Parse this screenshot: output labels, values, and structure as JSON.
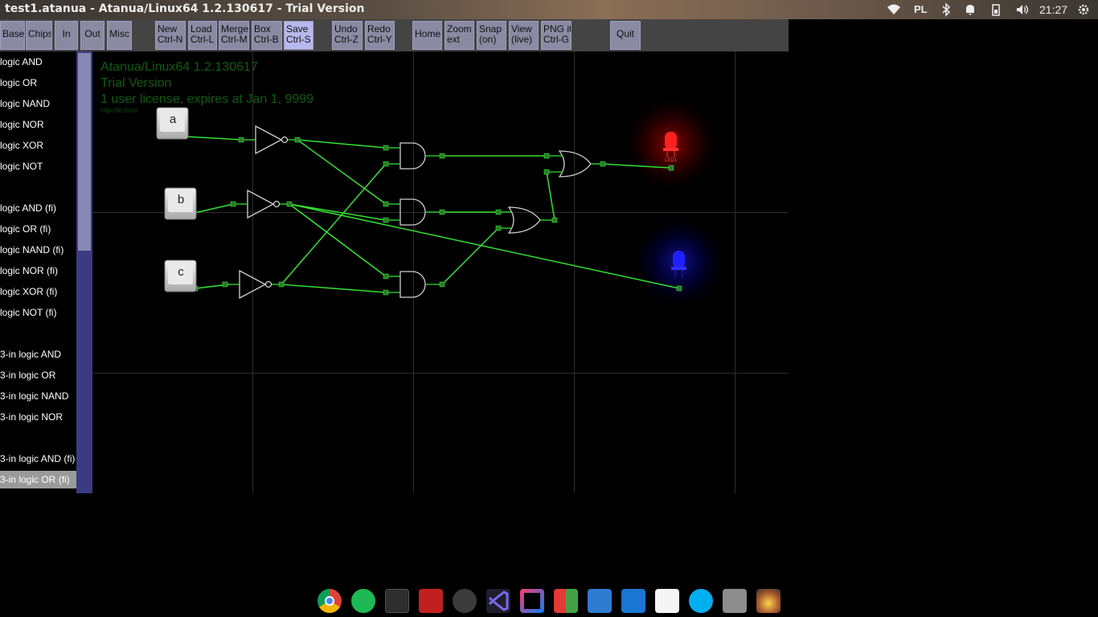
{
  "window": {
    "title": "test1.atanua - Atanua/Linux64 1.2.130617 - Trial Version"
  },
  "tray": {
    "keyboard_layout": "PL",
    "clock": "21:27"
  },
  "toolbar": {
    "base": "Base",
    "chips": "Chips",
    "in": "In",
    "out": "Out",
    "misc": "Misc",
    "new": "New\nCtrl-N",
    "load": "Load\nCtrl-L",
    "merge": "Merge\nCtrl-M",
    "box": "Box\nCtrl-B",
    "save": "Save\nCtrl-S",
    "undo": "Undo\nCtrl-Z",
    "redo": "Redo\nCtrl-Y",
    "home": "Home",
    "zoom": "Zoom\next",
    "snap": "Snap\n(on)",
    "view": "View\n(live)",
    "png": "PNG it\nCtrl-G",
    "quit": "Quit"
  },
  "components": [
    "logic AND",
    "logic OR",
    "logic NAND",
    "logic NOR",
    "logic XOR",
    "logic NOT",
    "",
    "logic AND (fi)",
    "logic OR (fi)",
    "logic NAND (fi)",
    "logic NOR (fi)",
    "logic XOR (fi)",
    "logic NOT (fi)",
    "",
    "3-in logic AND",
    "3-in logic OR",
    "3-in logic NAND",
    "3-in logic NOR",
    "",
    "3-in logic AND (fi)",
    "3-in logic OR (fi)"
  ],
  "selected_component": "3-in logic OR (fi)",
  "watermark": {
    "line1": "Atanua/Linux64 1.2.130617",
    "line2": "Trial Version",
    "line3": "1 user license, expires at Jan 1, 9999",
    "tiny": "http://iki.fi/sol"
  },
  "circuit": {
    "inputs": [
      "a",
      "b",
      "c"
    ],
    "led_label": "LED1",
    "colors": {
      "wire": "#33e033",
      "led_on": "#ff1a1a",
      "led_off": "#1a1aff",
      "gate": "#cfcfcf"
    }
  },
  "dock": [
    "chrome-icon",
    "spotify-icon",
    "terminal-icon",
    "app-icon",
    "atom-icon",
    "visual-studio-code-icon",
    "intellij-icon",
    "color-app-icon",
    "map-app-icon",
    "monitor-app-icon",
    "d-app-icon",
    "skype-icon",
    "files-icon",
    "photo-app-icon"
  ]
}
